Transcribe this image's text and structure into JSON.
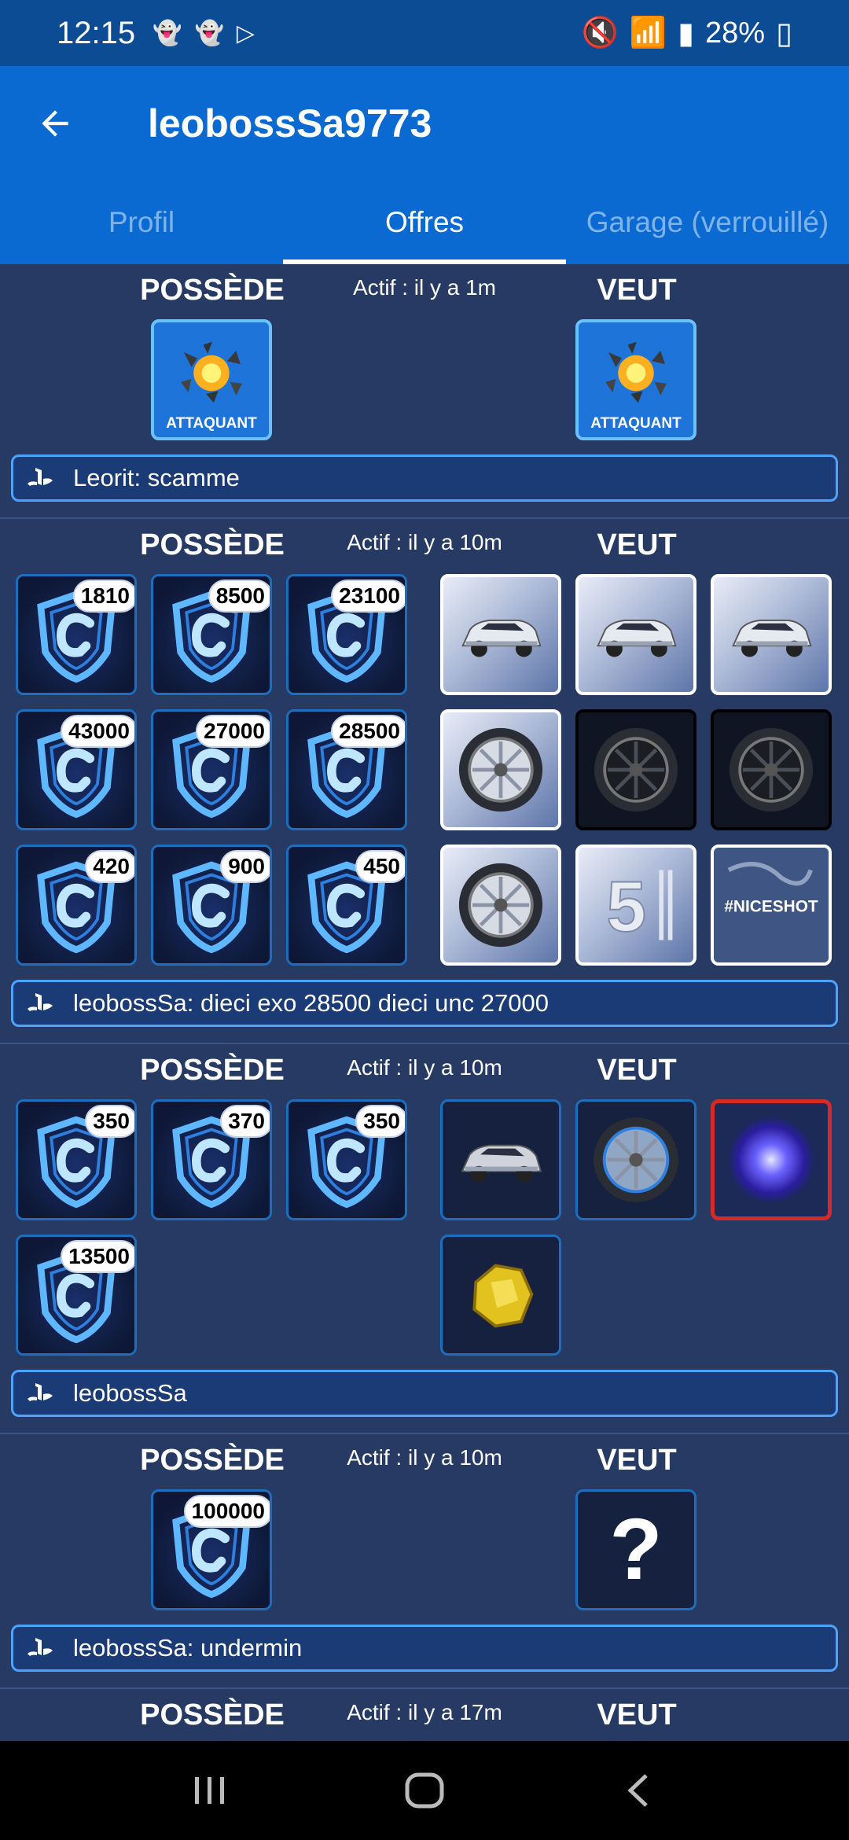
{
  "status": {
    "time": "12:15",
    "icons": [
      "snapchat-icon",
      "snapchat-icon",
      "play-store-icon",
      "mute-icon",
      "wifi-icon",
      "signal-icon"
    ],
    "battery": "28%"
  },
  "appbar": {
    "title": "leobossSa9773"
  },
  "tabs": [
    {
      "label": "Profil",
      "active": false
    },
    {
      "label": "Offres",
      "active": true
    },
    {
      "label": "Garage (verrouillé)",
      "active": false
    }
  ],
  "trades": [
    {
      "own_label": "POSSÈDE",
      "want_label": "VEUT",
      "active": "Actif : il y a 1m",
      "owns": [
        {
          "type": "attack",
          "label": "ATTAQUANT"
        }
      ],
      "wants": [
        {
          "type": "attack",
          "label": "ATTAQUANT"
        }
      ],
      "note": "Leorit: scamme"
    },
    {
      "own_label": "POSSÈDE",
      "want_label": "VEUT",
      "active": "Actif : il y a 10m",
      "owns": [
        {
          "type": "credits",
          "badge": "1810"
        },
        {
          "type": "credits",
          "badge": "8500"
        },
        {
          "type": "credits",
          "badge": "23100"
        },
        {
          "type": "credits",
          "badge": "43000"
        },
        {
          "type": "credits",
          "badge": "27000"
        },
        {
          "type": "credits",
          "badge": "28500"
        },
        {
          "type": "credits",
          "badge": "420"
        },
        {
          "type": "credits",
          "badge": "900"
        },
        {
          "type": "credits",
          "badge": "450"
        }
      ],
      "wants": [
        {
          "type": "car-light",
          "icon": "car-body-icon"
        },
        {
          "type": "car-light",
          "icon": "car-body-icon"
        },
        {
          "type": "car-light",
          "icon": "car-body-icon"
        },
        {
          "type": "wheel-light",
          "icon": "wheel-icon"
        },
        {
          "type": "wheel-dark",
          "icon": "wheel-icon"
        },
        {
          "type": "wheel-dark",
          "icon": "wheel-icon"
        },
        {
          "type": "wheel-light",
          "icon": "wheel-icon"
        },
        {
          "type": "number-light",
          "icon": "player-banner-icon",
          "text": "5"
        },
        {
          "type": "goal-light",
          "icon": "goal-explosion-icon",
          "text": "#NICESHOT"
        }
      ],
      "note": "leobossSa: dieci exo 28500 dieci unc 27000"
    },
    {
      "own_label": "POSSÈDE",
      "want_label": "VEUT",
      "active": "Actif : il y a 10m",
      "owns": [
        {
          "type": "credits",
          "badge": "350"
        },
        {
          "type": "credits",
          "badge": "370"
        },
        {
          "type": "credits",
          "badge": "350"
        },
        {
          "type": "credits",
          "badge": "13500"
        }
      ],
      "wants": [
        {
          "type": "car-dark",
          "icon": "car-body-icon"
        },
        {
          "type": "wheel-blue",
          "icon": "wheel-icon"
        },
        {
          "type": "galaxy-red",
          "icon": "nebula-icon"
        },
        {
          "type": "gold-dark",
          "icon": "gold-nugget-icon"
        }
      ],
      "note": "leobossSa"
    },
    {
      "own_label": "POSSÈDE",
      "want_label": "VEUT",
      "active": "Actif : il y a 10m",
      "owns": [
        {
          "type": "credits",
          "badge": "100000"
        }
      ],
      "wants": [
        {
          "type": "question",
          "text": "?"
        }
      ],
      "note": "leobossSa: undermin"
    },
    {
      "own_label": "POSSÈDE",
      "want_label": "VEUT",
      "active": "Actif : il y a 17m",
      "owns": [],
      "wants": [],
      "note": ""
    }
  ],
  "navbar": {
    "buttons": [
      "recents-icon",
      "home-icon",
      "back-icon"
    ]
  },
  "colors": {
    "appbar": "#0a6ad2",
    "statusbar": "#0b4c94",
    "background": "#263a63",
    "note_border": "#4da3ff"
  }
}
